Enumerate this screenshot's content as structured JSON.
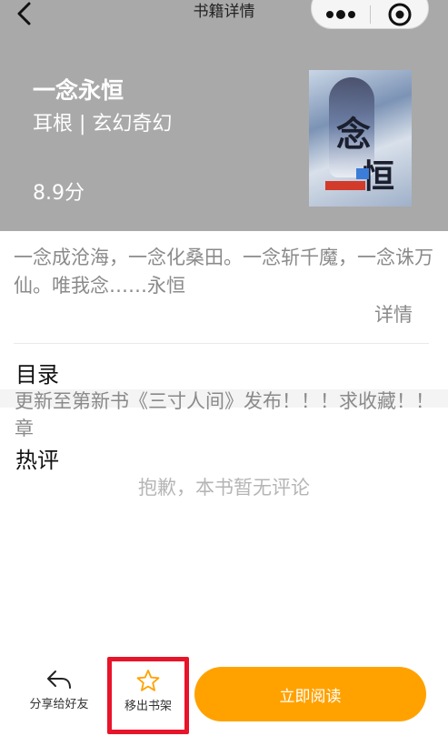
{
  "nav": {
    "title": "书籍详情"
  },
  "book": {
    "title": "一念永恒",
    "meta": "耳根 | 玄幻奇幻",
    "score": "8.9分",
    "intro": "一念成沧海，一念化桑田。一念斩千魔，一念诛万仙。唯我念……永恒",
    "detail_label": "详情"
  },
  "catalog": {
    "title": "目录",
    "latest": "更新至第新书《三寸人间》发布！！！求收藏！！章"
  },
  "reviews": {
    "title": "热评",
    "empty_text": "抱歉，本书暂无评论"
  },
  "bottom": {
    "share_label": "分享给好友",
    "shelf_label": "移出书架",
    "read_label": "立即阅读"
  },
  "colors": {
    "hero_bg": "#a9a9a9",
    "accent": "#ffa200",
    "highlight": "#e8142a"
  },
  "icons": [
    "back-icon",
    "more-icon",
    "close-target-icon",
    "share-icon",
    "star-icon"
  ]
}
